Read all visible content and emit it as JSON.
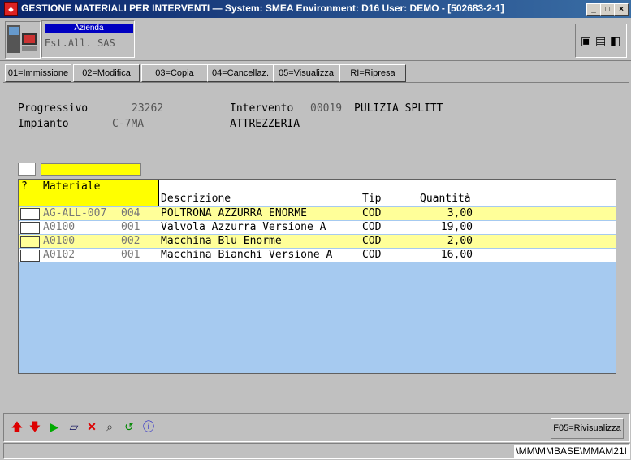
{
  "window": {
    "app_icon": "app-icon",
    "title": "GESTIONE MATERIALI PER INTERVENTI — System: SMEA Environment: D16 User: DEMO - [502683-2-1]",
    "controls": [
      "_",
      "□",
      "×"
    ]
  },
  "header": {
    "company_label": "Azienda",
    "company_value": "Est.All. SAS"
  },
  "functions": [
    {
      "label": "01=Immissione"
    },
    {
      "label": "02=Modifica"
    },
    {
      "label": "03=Copia"
    },
    {
      "label": "04=Cancellaz."
    },
    {
      "label": "05=Visualizza"
    },
    {
      "label": "RI=Ripresa"
    }
  ],
  "form": {
    "progressivo_label": "Progressivo",
    "progressivo_value": "23262",
    "intervento_label": "Intervento",
    "intervento_code": "00019",
    "intervento_desc": "PULIZIA SPLITT",
    "impianto_label": "Impianto",
    "impianto_value": "C-7MA",
    "impianto_desc": "ATTREZZERIA"
  },
  "grid": {
    "columns": {
      "q": "?",
      "materiale": "Materiale",
      "descrizione": "Descrizione",
      "tip": "Tip",
      "quantita": "Quantità"
    },
    "rows": [
      {
        "code": "AG-ALL-007",
        "ver": "004",
        "desc": "POLTRONA AZZURRA ENORME",
        "tip": "COD",
        "qty": "3,00",
        "bg": "#ffff99"
      },
      {
        "code": "A0100",
        "ver": "001",
        "desc": "Valvola Azzurra Versione A",
        "tip": "COD",
        "qty": "19,00",
        "bg": "#ffffff"
      },
      {
        "code": "A0100",
        "ver": "002",
        "desc": "Macchina Blu Enorme",
        "tip": "COD",
        "qty": "2,00",
        "bg": "#ffff99"
      },
      {
        "code": "A0102",
        "ver": "001",
        "desc": "Macchina Bianchi Versione A",
        "tip": "COD",
        "qty": "16,00",
        "bg": "#ffffff"
      }
    ]
  },
  "toolbar": {
    "buttons": [
      "arrow-up-icon",
      "arrow-down-icon",
      "play-icon",
      "eraser-icon",
      "delete-icon",
      "search-icon",
      "refresh-icon",
      "info-icon"
    ],
    "f05_label": "F05=Rivisualizza"
  },
  "status": {
    "path": "\\MM\\MMBASE\\MMAM21I"
  }
}
